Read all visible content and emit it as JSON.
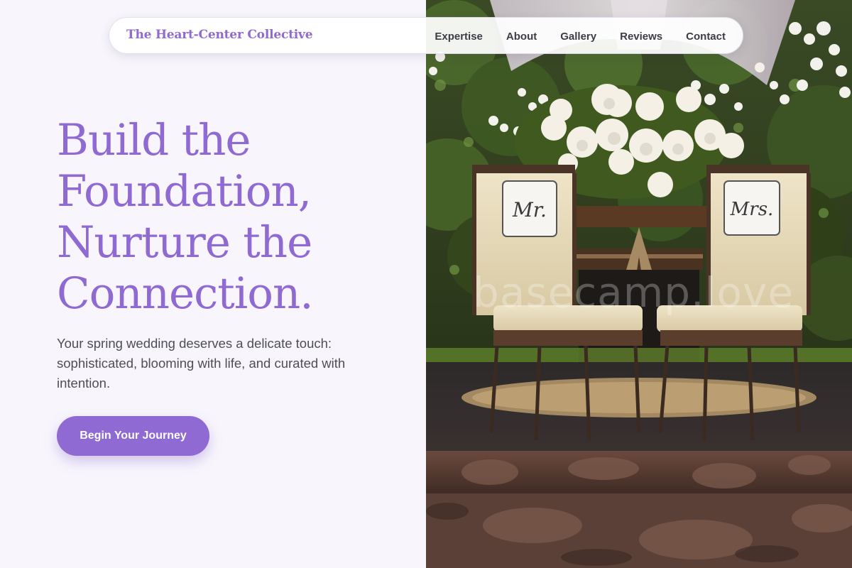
{
  "brand": {
    "name": "The Heart-Center Collective",
    "accent_color": "#8f6ad3"
  },
  "nav": {
    "items": [
      {
        "label": "Expertise"
      },
      {
        "label": "About"
      },
      {
        "label": "Gallery"
      },
      {
        "label": "Reviews"
      },
      {
        "label": "Contact"
      }
    ]
  },
  "hero": {
    "headline_lines": [
      "Build the",
      "Foundation,",
      "Nurture the",
      "Connection."
    ],
    "subtext": "Your spring wedding deserves a delicate touch: sophisticated, blooming with life, and curated with intention.",
    "cta_label": "Begin Your Journey"
  },
  "image": {
    "chair_sign_left": "Mr.",
    "chair_sign_right": "Mrs.",
    "watermark": "basecamp.love"
  }
}
